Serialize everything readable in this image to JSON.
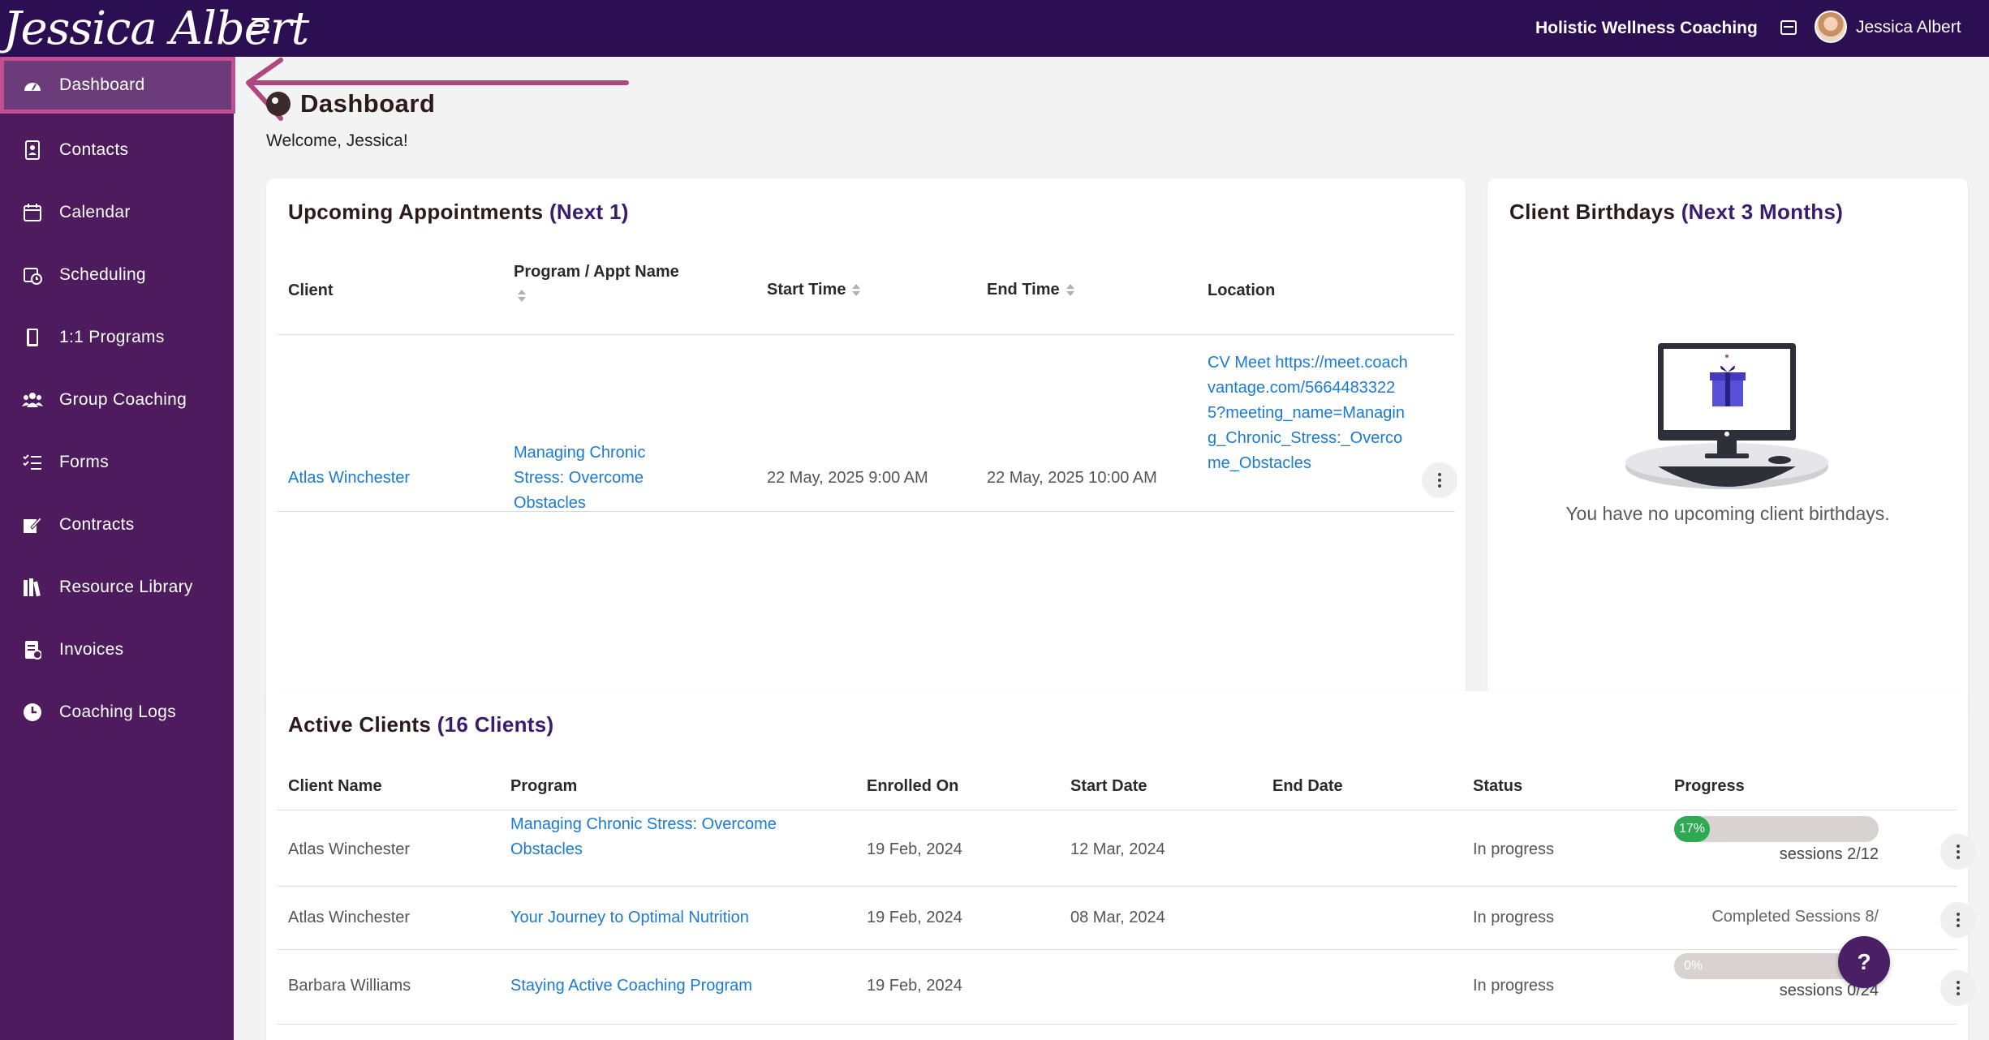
{
  "topbar": {
    "logo_text": "Jessica Albert",
    "business_name": "Holistic Wellness Coaching",
    "user_name": "Jessica Albert"
  },
  "sidebar": {
    "items": [
      {
        "label": "Dashboard",
        "icon": "gauge-icon",
        "active": true
      },
      {
        "label": "Contacts",
        "icon": "contact-book-icon"
      },
      {
        "label": "Calendar",
        "icon": "calendar-icon"
      },
      {
        "label": "Scheduling",
        "icon": "calendar-clock-icon"
      },
      {
        "label": "1:1 Programs",
        "icon": "book-icon"
      },
      {
        "label": "Group Coaching",
        "icon": "users-icon"
      },
      {
        "label": "Forms",
        "icon": "checklist-icon"
      },
      {
        "label": "Contracts",
        "icon": "signature-icon"
      },
      {
        "label": "Resource Library",
        "icon": "books-icon"
      },
      {
        "label": "Invoices",
        "icon": "invoice-icon"
      },
      {
        "label": "Coaching Logs",
        "icon": "clock-icon"
      }
    ]
  },
  "page": {
    "title": "Dashboard",
    "welcome": "Welcome, Jessica!"
  },
  "appointments": {
    "title": "Upcoming Appointments",
    "title_accent": "(Next 1)",
    "columns": [
      "Client",
      "Program / Appt Name",
      "Start Time",
      "End Time",
      "Location"
    ],
    "rows": [
      {
        "client": "Atlas Winchester",
        "program": "Managing Chronic Stress: Overcome Obstacles",
        "start": "22 May, 2025 9:00 AM",
        "end": "22 May, 2025 10:00 AM",
        "location": "CV Meet https://meet.coachvantage.com/56644833225?meeting_name=Managing_Chronic_Stress:_Overcome_Obstacles"
      }
    ]
  },
  "birthdays": {
    "title": "Client Birthdays",
    "title_accent": "(Next 3 Months)",
    "empty_message": "You have no upcoming client birthdays."
  },
  "active_clients": {
    "title": "Active Clients",
    "title_accent": "(16 Clients)",
    "columns": [
      "Client Name",
      "Program",
      "Enrolled On",
      "Start Date",
      "End Date",
      "Status",
      "Progress"
    ],
    "rows": [
      {
        "name": "Atlas Winchester",
        "program": "Managing Chronic Stress: Overcome Obstacles",
        "enrolled": "19 Feb, 2024",
        "start": "12 Mar, 2024",
        "end": "",
        "status": "In progress",
        "progress_label": "17%",
        "progress_fraction": 0.17,
        "caption": "sessions 2/12"
      },
      {
        "name": "Atlas Winchester",
        "program": "Your Journey to Optimal Nutrition",
        "enrolled": "19 Feb, 2024",
        "start": "08 Mar, 2024",
        "end": "",
        "status": "In progress",
        "caption": "Completed Sessions 8/"
      },
      {
        "name": "Barbara Williams",
        "program": "Staying Active Coaching Program",
        "enrolled": "19 Feb, 2024",
        "start": "",
        "end": "",
        "status": "In progress",
        "progress_label": "0%",
        "progress_fraction": 0.0,
        "caption": "sessions 0/24"
      }
    ]
  },
  "help": {
    "label": "?"
  },
  "colors": {
    "topbar": "#2c0f52",
    "sidebar": "#4e1c5e",
    "active_border": "#c0508e",
    "link": "#1a7ad4",
    "accent": "#3a1c6e",
    "progress": "#2eaa52"
  }
}
